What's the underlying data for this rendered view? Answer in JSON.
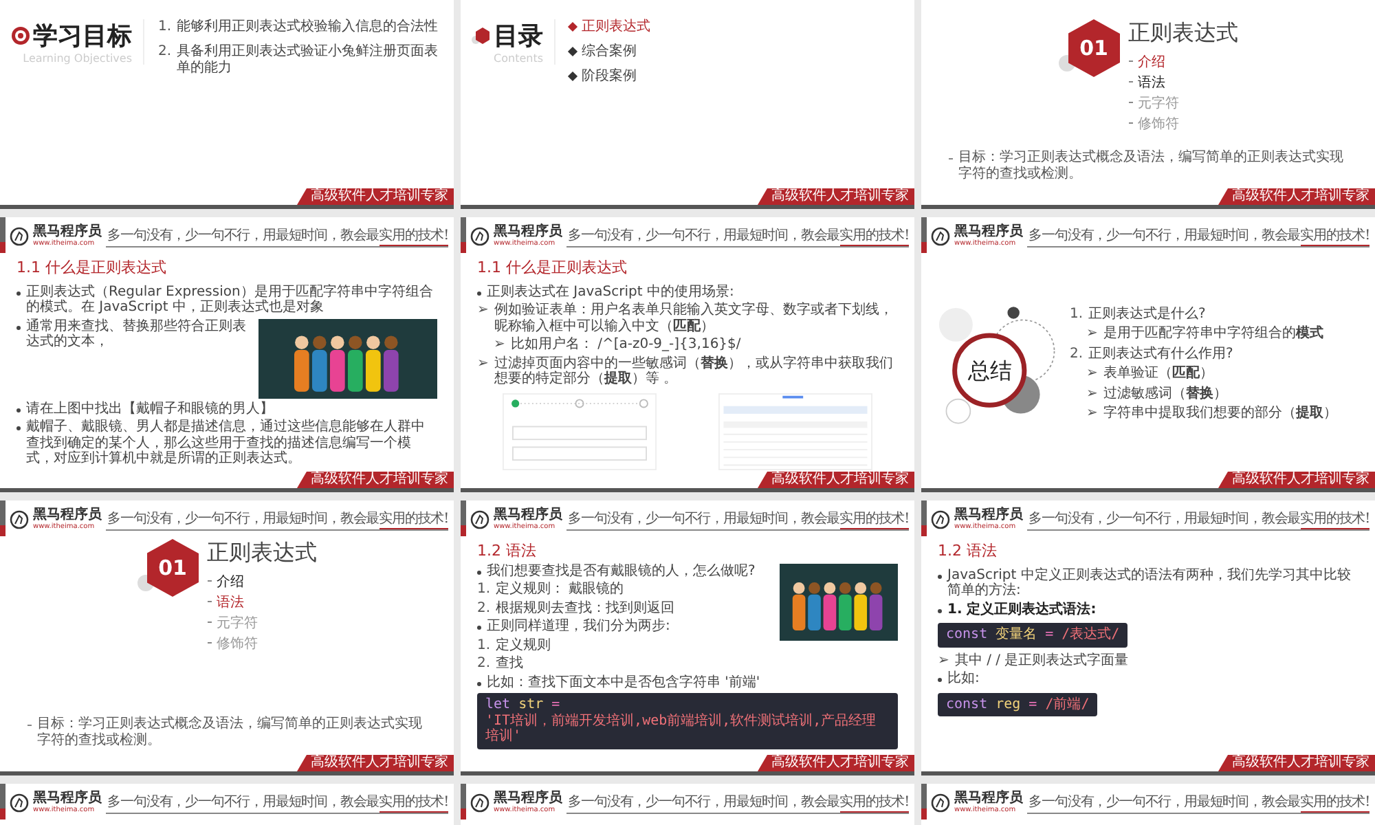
{
  "slides": [
    {
      "kind": "objectives",
      "title": "学习目标",
      "subtitle": "Learning Objectives",
      "items": [
        {
          "number": "1.",
          "text": "能够利用正则表达式校验输入信息的合法性"
        },
        {
          "number": "2.",
          "text": "具备利用正则表达式验证小兔鲜注册页面表单的能力"
        }
      ],
      "footer": "高级软件人才培训专家"
    },
    {
      "kind": "contents",
      "title": "目录",
      "subtitle": "Contents",
      "items": [
        {
          "label": "正则表达式",
          "selected": true
        },
        {
          "label": "综合案例",
          "selected": false
        },
        {
          "label": "阶段案例",
          "selected": false
        }
      ],
      "footer": "高级软件人才培训专家"
    },
    {
      "kind": "section",
      "number": "01",
      "title": "正则表达式",
      "items": [
        {
          "label": "介绍",
          "selected": true,
          "muted": false
        },
        {
          "label": "语法",
          "selected": false,
          "muted": false
        },
        {
          "label": "元字符",
          "selected": false,
          "muted": true
        },
        {
          "label": "修饰符",
          "selected": false,
          "muted": true
        }
      ],
      "goal": "目标：学习正则表达式概念及语法，编写简单的正则表达式实现字符的查找或检测。",
      "footer": "高级软件人才培训专家"
    },
    {
      "kind": "content",
      "header": {
        "brand": "黑马程序员",
        "url": "www.itheima.com",
        "slogan": "多一句没有，少一句不行，用最短时间，教会最实用的技术!"
      },
      "title": "1.1 什么是正则表达式",
      "blocks": [
        {
          "kind": "bullet",
          "text": "正则表达式（Regular Expression）是用于匹配字符串中字符组合的模式。在 JavaScript 中，正则表达式也是对象"
        },
        {
          "kind": "bullet_picture",
          "text": "通常用来查找、替换那些符合正则表达式的文本，"
        },
        {
          "kind": "bullet",
          "text": "请在上图中找出【戴帽子和眼镜的男人】"
        },
        {
          "kind": "bullet",
          "text": "戴帽子、戴眼镜、男人都是描述信息，通过这些信息能够在人群中查找到确定的某个人，那么这些用于查找的描述信息编写一个模式，对应到计算机中就是所谓的正则表达式。"
        }
      ],
      "footer": "高级软件人才培训专家"
    },
    {
      "kind": "content",
      "header": {
        "brand": "黑马程序员",
        "url": "www.itheima.com",
        "slogan": "多一句没有，少一句不行，用最短时间，教会最实用的技术!"
      },
      "title": "1.1 什么是正则表达式",
      "blocks": [
        {
          "kind": "bullet",
          "text": "正则表达式在 JavaScript 中的使用场景:"
        },
        {
          "kind": "arrow",
          "marker": "➢",
          "text": "例如验证表单：用户名表单只能输入英文字母、数字或者下划线，昵称输入框中可以输入中文（**匹配**）"
        },
        {
          "kind": "sub_arrow",
          "marker": "➢",
          "text": "比如用户名： /^[a-z0-9_-]{3,16}$/"
        },
        {
          "kind": "arrow",
          "marker": "➢",
          "text": "过滤掉页面内容中的一些敏感词（**替换**），或从字符串中获取我们想要的特定部分（**提取**）等 。"
        },
        {
          "kind": "screenshots"
        }
      ],
      "footer": "高级软件人才培训专家"
    },
    {
      "kind": "summary",
      "header": {
        "brand": "黑马程序员",
        "url": "www.itheima.com",
        "slogan": "多一句没有，少一句不行，用最短时间，教会最实用的技术!"
      },
      "label": "总结",
      "blocks": [
        {
          "kind": "number",
          "marker": "1.",
          "text": "正则表达式是什么?"
        },
        {
          "kind": "sub_arrow",
          "marker": "➢",
          "text": "是用于匹配字符串中字符组合的**模式**"
        },
        {
          "kind": "number",
          "marker": "2.",
          "text": "正则表达式有什么作用?"
        },
        {
          "kind": "sub_arrow",
          "marker": "➢",
          "text": "表单验证（**匹配**）"
        },
        {
          "kind": "sub_arrow",
          "marker": "➢",
          "text": "过滤敏感词（**替换**）"
        },
        {
          "kind": "sub_arrow",
          "marker": "➢",
          "text": "字符串中提取我们想要的部分（**提取**）"
        }
      ],
      "footer": "高级软件人才培训专家"
    },
    {
      "kind": "section",
      "header": {
        "brand": "黑马程序员",
        "url": "www.itheima.com",
        "slogan": "多一句没有，少一句不行，用最短时间，教会最实用的技术!"
      },
      "number": "01",
      "title": "正则表达式",
      "items": [
        {
          "label": "介绍",
          "selected": false,
          "muted": false
        },
        {
          "label": "语法",
          "selected": true,
          "muted": false
        },
        {
          "label": "元字符",
          "selected": false,
          "muted": true
        },
        {
          "label": "修饰符",
          "selected": false,
          "muted": true
        }
      ],
      "goal": "目标：学习正则表达式概念及语法，编写简单的正则表达式实现字符的查找或检测。",
      "footer": "高级软件人才培训专家"
    },
    {
      "kind": "content",
      "header": {
        "brand": "黑马程序员",
        "url": "www.itheima.com",
        "slogan": "多一句没有，少一句不行，用最短时间，教会最实用的技术!"
      },
      "title": "1.2 语法",
      "blocks": [
        {
          "kind": "bullet",
          "text": "我们想要查找是否有戴眼镜的人，怎么做呢?"
        },
        {
          "kind": "number",
          "marker": "1.",
          "text": "定义规则： 戴眼镜的"
        },
        {
          "kind": "number",
          "marker": "2.",
          "text": "根据规则去查找：找到则返回"
        },
        {
          "kind": "bullet",
          "text": "正则同样道理，我们分为两步:"
        },
        {
          "kind": "number",
          "marker": "1.",
          "text": "定义规则"
        },
        {
          "kind": "number",
          "marker": "2.",
          "text": "查找"
        },
        {
          "kind": "bullet",
          "text": "比如：查找下面文本中是否包含字符串 '前端'"
        },
        {
          "kind": "code",
          "tokens": [
            {
              "color": "#c792ea",
              "text": "let"
            },
            {
              "color": "#f1d27a",
              "text": "str"
            },
            {
              "color": "#ff79c6",
              "text": "="
            },
            {
              "color": "#f07178",
              "text": "'IT培训，前端开发培训,web前端培训,软件测试培训,产品经理培训'"
            }
          ]
        }
      ],
      "footer": "高级软件人才培训专家"
    },
    {
      "kind": "content",
      "header": {
        "brand": "黑马程序员",
        "url": "www.itheima.com",
        "slogan": "多一句没有，少一句不行，用最短时间，教会最实用的技术!"
      },
      "title": "1.2 语法",
      "blocks": [
        {
          "kind": "bullet",
          "text": "JavaScript 中定义正则表达式的语法有两种，我们先学习其中比较简单的方法:"
        },
        {
          "kind": "strong_bullet",
          "text": "1. 定义正则表达式语法:"
        },
        {
          "kind": "code",
          "tokens": [
            {
              "color": "#c792ea",
              "text": "const"
            },
            {
              "color": "#f1d27a",
              "text": "变量名"
            },
            {
              "color": "#ff79c6",
              "text": "="
            },
            {
              "color": "#f07178",
              "text": "/表达式/"
            }
          ]
        },
        {
          "kind": "arrow",
          "marker": "➢",
          "text": "其中 /  / 是正则表达式字面量"
        },
        {
          "kind": "bullet",
          "text": "比如:"
        },
        {
          "kind": "code",
          "tokens": [
            {
              "color": "#c792ea",
              "text": "const"
            },
            {
              "color": "#f1d27a",
              "text": "reg"
            },
            {
              "color": "#ff79c6",
              "text": "="
            },
            {
              "color": "#f07178",
              "text": "/前端/"
            }
          ]
        }
      ],
      "footer": "高级软件人才培训专家"
    },
    {
      "kind": "content",
      "header": {
        "brand": "黑马程序员",
        "url": "www.itheima.com",
        "slogan": "多一句没有，少一句不行，用最短时间，教会最实用的技术!"
      }
    },
    {
      "kind": "content",
      "header": {
        "brand": "黑马程序员",
        "url": "www.itheima.com",
        "slogan": "多一句没有，少一句不行，用最短时间，教会最实用的技术!"
      }
    },
    {
      "kind": "content",
      "header": {
        "brand": "黑马程序员",
        "url": "www.itheima.com",
        "slogan": "多一句没有，少一句不行，用最短时间，教会最实用的技术!"
      }
    }
  ]
}
